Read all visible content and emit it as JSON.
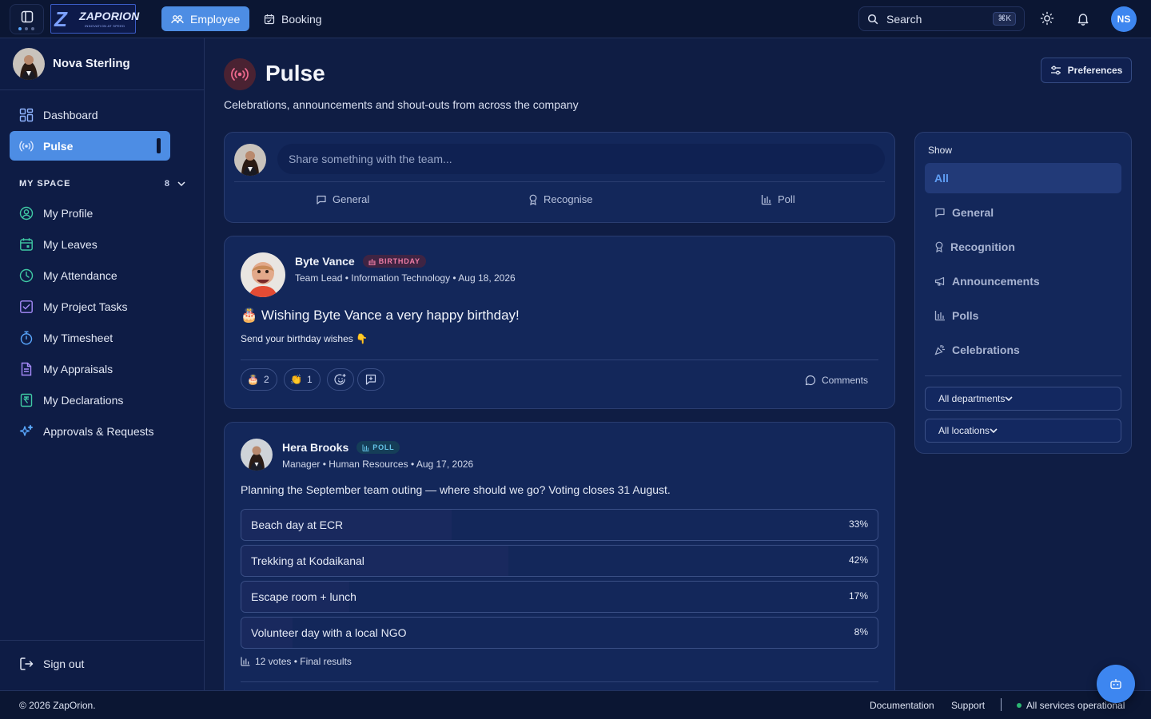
{
  "topbar": {
    "logo": {
      "wordmark": "ZAPORION",
      "tagline": "INNOVATION AT SPEED"
    },
    "nav": [
      {
        "label": "Employee",
        "active": true
      },
      {
        "label": "Booking",
        "active": false
      }
    ],
    "search": {
      "placeholder": "Search",
      "shortcut": "⌘K"
    },
    "avatar_initials": "NS"
  },
  "sidebar": {
    "user_name": "Nova Sterling",
    "primary": [
      {
        "label": "Dashboard",
        "icon": "dashboard-grid-icon"
      },
      {
        "label": "Pulse",
        "icon": "broadcast-icon",
        "active": true
      }
    ],
    "section": {
      "title": "MY SPACE",
      "count": "8"
    },
    "items": [
      {
        "label": "My Profile",
        "icon": "user-circle-icon"
      },
      {
        "label": "My Leaves",
        "icon": "calendar-icon"
      },
      {
        "label": "My Attendance",
        "icon": "clock-icon"
      },
      {
        "label": "My Project Tasks",
        "icon": "checkbox-icon"
      },
      {
        "label": "My Timesheet",
        "icon": "stopwatch-icon"
      },
      {
        "label": "My Appraisals",
        "icon": "document-icon"
      },
      {
        "label": "My Declarations",
        "icon": "rupee-document-icon"
      },
      {
        "label": "Approvals & Requests",
        "icon": "sparkle-icon"
      }
    ],
    "signout": "Sign out"
  },
  "page": {
    "title": "Pulse",
    "subtitle": "Celebrations, announcements and shout-outs from across the company",
    "preferences_label": "Preferences"
  },
  "composer": {
    "placeholder": "Share something with the team...",
    "actions": [
      {
        "label": "General",
        "icon": "chat-icon"
      },
      {
        "label": "Recognise",
        "icon": "award-icon"
      },
      {
        "label": "Poll",
        "icon": "bar-chart-icon"
      }
    ]
  },
  "posts": [
    {
      "author": "Byte Vance",
      "badge": "BIRTHDAY",
      "meta": "Team Lead • Information Technology • Aug 18, 2026",
      "headline": "🎂 Wishing Byte Vance a very happy birthday!",
      "subline": "Send your birthday wishes 👇",
      "reactions": [
        {
          "emoji": "🎂",
          "count": "2"
        },
        {
          "emoji": "👏",
          "count": "1"
        }
      ],
      "comments_label": "Comments"
    },
    {
      "author": "Hera Brooks",
      "badge": "POLL",
      "meta": "Manager • Human Resources • Aug 17, 2026",
      "question": "Planning the September team outing — where should we go? Voting closes 31 August.",
      "options": [
        {
          "label": "Beach day at ECR",
          "pct": "33%",
          "value": 33
        },
        {
          "label": "Trekking at Kodaikanal",
          "pct": "42%",
          "value": 42
        },
        {
          "label": "Escape room + lunch",
          "pct": "17%",
          "value": 17
        },
        {
          "label": "Volunteer day with a local NGO",
          "pct": "8%",
          "value": 8
        }
      ],
      "footer": "12 votes • Final results"
    }
  ],
  "filters": {
    "title": "Show",
    "options": [
      {
        "label": "All",
        "active": true,
        "icon": ""
      },
      {
        "label": "General",
        "icon": "chat-icon"
      },
      {
        "label": "Recognition",
        "icon": "award-icon"
      },
      {
        "label": "Announcements",
        "icon": "megaphone-icon"
      },
      {
        "label": "Polls",
        "icon": "bar-chart-icon"
      },
      {
        "label": "Celebrations",
        "icon": "party-icon"
      }
    ],
    "department": "All departments",
    "location": "All locations"
  },
  "footer": {
    "copyright": "© 2026 ZapOrion.",
    "links": [
      "Documentation",
      "Support"
    ],
    "status": "All services operational"
  },
  "colors": {
    "accent": "#4d8de4",
    "background": "#0f1d44",
    "card": "#13275a",
    "birthday": "#f07da6",
    "poll": "#64c2e6",
    "status_ok": "#2bb673"
  }
}
